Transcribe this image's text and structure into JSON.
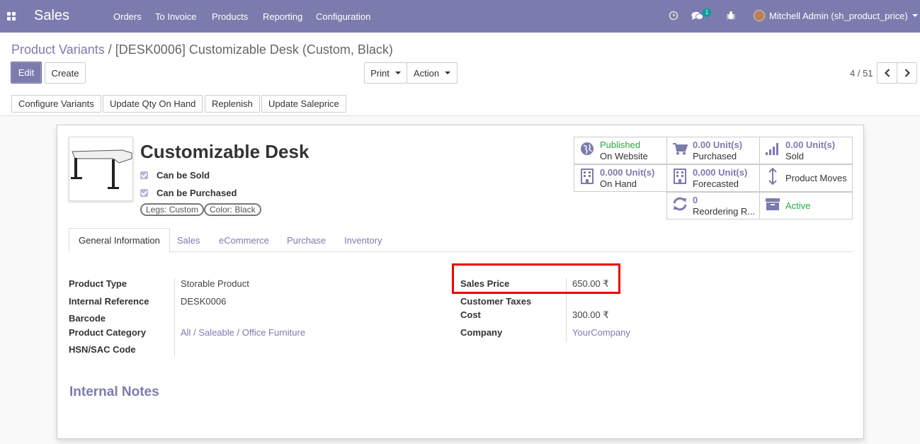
{
  "navbar": {
    "app_name": "Sales",
    "menus": [
      "Orders",
      "To Invoice",
      "Products",
      "Reporting",
      "Configuration"
    ],
    "chat_count": "1",
    "user_name": "Mitchell Admin (sh_product_price)",
    "icons": [
      "apps-grid-icon",
      "clock-icon",
      "chat-icon",
      "bug-icon"
    ]
  },
  "breadcrumb": {
    "parent": "Product Variants",
    "separator": "/",
    "current": "[DESK0006] Customizable Desk (Custom, Black)"
  },
  "buttons": {
    "edit": "Edit",
    "create": "Create",
    "print": "Print",
    "action": "Action",
    "configure_variants": "Configure Variants",
    "update_qty": "Update Qty On Hand",
    "replenish": "Replenish",
    "update_saleprice": "Update Saleprice"
  },
  "pager": {
    "text": "4 / 51"
  },
  "product": {
    "name": "Customizable Desk",
    "can_be_sold": "Can be Sold",
    "can_be_purchased": "Can be Purchased",
    "tags": [
      "Legs: Custom",
      "Color: Black"
    ]
  },
  "smart_buttons": {
    "published": {
      "value": "Published",
      "label": "On Website",
      "icon": "globe-icon"
    },
    "purchased": {
      "value": "0.00 Unit(s)",
      "label": "Purchased",
      "icon": "cart-icon"
    },
    "sold": {
      "value": "0.00 Unit(s)",
      "label": "Sold",
      "icon": "signal-icon"
    },
    "on_hand": {
      "value": "0.000 Unit(s)",
      "label": "On Hand",
      "icon": "building-icon"
    },
    "forecasted": {
      "value": "0.000 Unit(s)",
      "label": "Forecasted",
      "icon": "building-icon"
    },
    "moves": {
      "label": "Product Moves",
      "icon": "updown-arrow-icon"
    },
    "reordering": {
      "value": "0",
      "label": "Reordering R...",
      "icon": "refresh-icon"
    },
    "active": {
      "label": "Active",
      "icon": "archive-icon"
    }
  },
  "tabs": [
    "General Information",
    "Sales",
    "eCommerce",
    "Purchase",
    "Inventory"
  ],
  "fields_left": {
    "product_type": {
      "label": "Product Type",
      "value": "Storable Product"
    },
    "internal_ref": {
      "label": "Internal Reference",
      "value": "DESK0006"
    },
    "barcode": {
      "label": "Barcode",
      "value": ""
    },
    "category": {
      "label": "Product Category",
      "value": "All / Saleable / Office Furniture"
    },
    "hsn": {
      "label": "HSN/SAC Code",
      "value": ""
    }
  },
  "fields_right": {
    "sales_price": {
      "label": "Sales Price",
      "value": "650.00 ₹"
    },
    "customer_taxes": {
      "label": "Customer Taxes",
      "value": ""
    },
    "cost": {
      "label": "Cost",
      "value": "300.00 ₹"
    },
    "company": {
      "label": "Company",
      "value": "YourCompany"
    }
  },
  "notes": {
    "title": "Internal Notes"
  },
  "colors": {
    "brand": "#7c7bad",
    "highlight": "#ee0000",
    "success": "#28a745"
  }
}
